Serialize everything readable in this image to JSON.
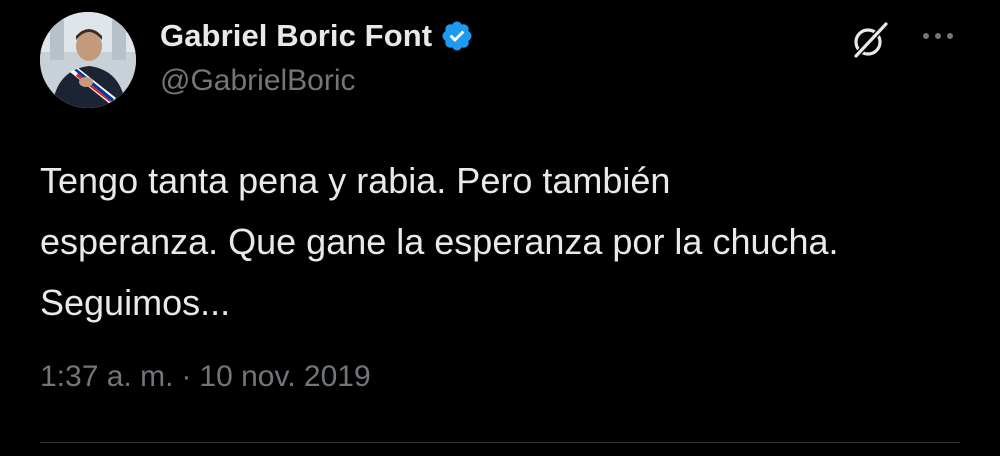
{
  "author": {
    "display_name": "Gabriel Boric Font",
    "handle": "@GabrielBoric",
    "verified_icon": "verified-badge-icon",
    "avatar_icon": "avatar"
  },
  "header_actions": {
    "grok_icon": "grok-icon",
    "more_icon": "more-options-icon"
  },
  "tweet": {
    "text": "Tengo tanta pena y rabia. Pero también\nesperanza. Que gane la esperanza por la chucha.\nSeguimos...",
    "time": "1:37 a. m.",
    "separator": "·",
    "date": "10 nov. 2019"
  },
  "colors": {
    "background": "#000000",
    "primary_text": "#e7e9ea",
    "secondary_text": "#71767b",
    "verified_blue": "#1d9bf0",
    "divider": "#2f3336"
  }
}
